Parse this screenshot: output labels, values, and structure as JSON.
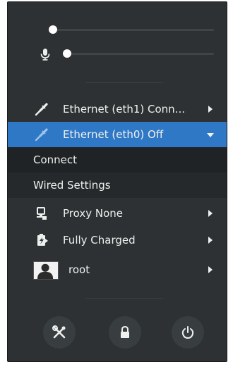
{
  "sliders": {
    "volume": {
      "level": 0.0
    },
    "microphone": {
      "level": 0.0
    }
  },
  "network": {
    "eth1_label": "Ethernet (eth1) Conn...",
    "eth0_label": "Ethernet (eth0) Off",
    "submenu": {
      "connect_label": "Connect",
      "wired_settings_label": "Wired Settings"
    }
  },
  "proxy": {
    "label": "Proxy None"
  },
  "battery": {
    "label": "Fully Charged"
  },
  "user": {
    "label": "root"
  },
  "actions": {
    "settings_icon": "settings-icon",
    "lock_icon": "lock-icon",
    "power_icon": "power-icon"
  },
  "colors": {
    "menu_background": "#2d3133",
    "selected_highlight": "#2f78c6",
    "submenu_background": "#202325",
    "text": "#eef0ee"
  }
}
